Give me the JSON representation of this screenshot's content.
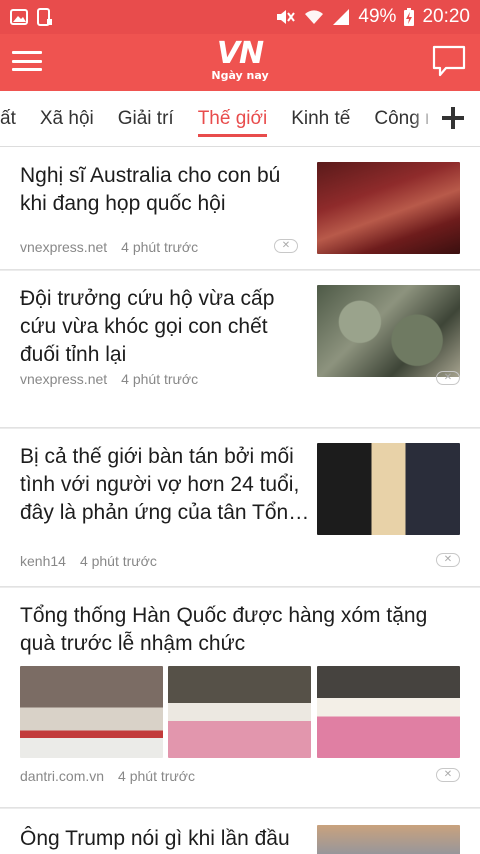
{
  "status_bar": {
    "battery": "49%",
    "time": "20:20",
    "bg_color": "#e84c4c"
  },
  "app_bar": {
    "logo_mark": "VN",
    "logo_sub": "Ngày nay",
    "bg_color": "#ef5350"
  },
  "tabs": {
    "items": [
      {
        "label": "ất"
      },
      {
        "label": "Xã hội"
      },
      {
        "label": "Giải trí"
      },
      {
        "label": "Thế giới",
        "active": true
      },
      {
        "label": "Kinh tế"
      },
      {
        "label": "Công n"
      }
    ],
    "accent_color": "#e84c4c"
  },
  "feed": {
    "articles": [
      {
        "title": "Nghị sĩ Australia cho con bú khi đang họp quốc hội",
        "source": "vnexpress.net",
        "time": "4 phút trước"
      },
      {
        "title": "Đội trưởng cứu hộ vừa cấp cứu vừa khóc gọi con chết đuối tỉnh lại",
        "source": "vnexpress.net",
        "time": "4 phút trước"
      },
      {
        "title": "Bị cả thế giới bàn tán bởi mối tình với người vợ hơn 24 tuổi, đây là phản ứng của tân Tổn…",
        "source": "kenh14",
        "time": "4 phút trước"
      },
      {
        "title": "Tổng thống Hàn Quốc được hàng xóm tặng quà trước lễ nhậm chức",
        "source": "dantri.com.vn",
        "time": "4 phút trước"
      },
      {
        "title": "Ông Trump nói gì khi lần đầu"
      }
    ]
  }
}
